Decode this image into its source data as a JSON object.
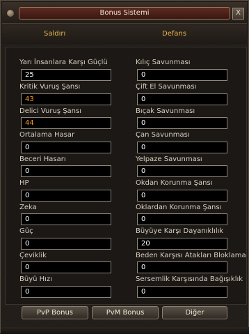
{
  "window": {
    "title": "Bonus Sistemi",
    "close_glyph": "X"
  },
  "columns": {
    "left_header": "Saldırı",
    "right_header": "Defans"
  },
  "colors": {
    "header_text": "#e8b84a",
    "highlight_value": "#ff9a1a",
    "title_plate": "#5b2a20"
  },
  "attack_stats": [
    {
      "label": "Yarı İnsanlara Karşı Güçlü",
      "value": "25",
      "highlight": false
    },
    {
      "label": "Kritik Vuruş Şansı",
      "value": "43",
      "highlight": true
    },
    {
      "label": "Delici Vuruş Şansı",
      "value": "44",
      "highlight": true
    },
    {
      "label": "Ortalama Hasar",
      "value": "0",
      "highlight": false
    },
    {
      "label": "Beceri Hasarı",
      "value": "0",
      "highlight": false
    },
    {
      "label": "HP",
      "value": "0",
      "highlight": false
    },
    {
      "label": "Zeka",
      "value": "0",
      "highlight": false
    },
    {
      "label": "Güç",
      "value": "0",
      "highlight": false
    },
    {
      "label": "Çeviklik",
      "value": "0",
      "highlight": false
    },
    {
      "label": "Büyü Hızı",
      "value": "0",
      "highlight": false
    }
  ],
  "defense_stats": [
    {
      "label": "Kılıç Savunması",
      "value": "0"
    },
    {
      "label": "Çift El Savunması",
      "value": "0"
    },
    {
      "label": "Bıçak Savunması",
      "value": "0"
    },
    {
      "label": "Çan Savunması",
      "value": "0"
    },
    {
      "label": "Yelpaze Savunması",
      "value": "0"
    },
    {
      "label": "Okdan Korunma Şansı",
      "value": "0"
    },
    {
      "label": "Oklardan Korunma Şansı",
      "value": "0"
    },
    {
      "label": "Büyüye Karşı Dayanıklılık",
      "value": "20"
    },
    {
      "label": "Beden Karşısı Atakları Bloklama",
      "value": "0"
    },
    {
      "label": "Sersemlik Karşısında Bağışıklık",
      "value": "0"
    }
  ],
  "buttons": {
    "pvp": "PvP Bonus",
    "pvm": "PvM Bonus",
    "other": "Diğer"
  }
}
